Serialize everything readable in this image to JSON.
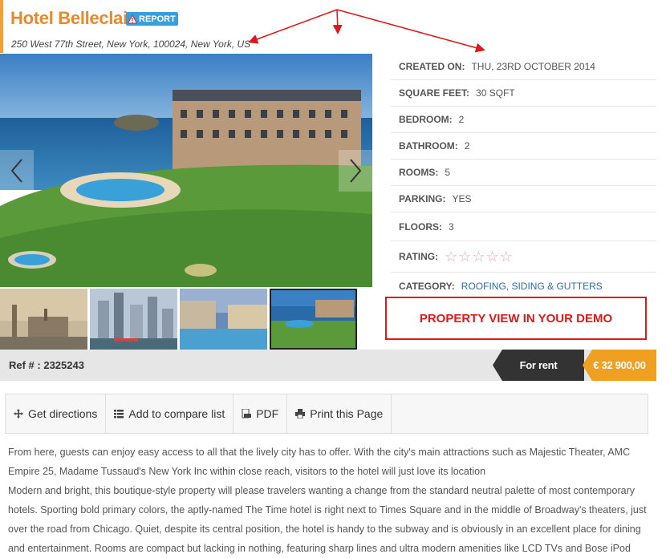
{
  "header": {
    "title": "Hotel Belleclaire",
    "report_label": "REPORT",
    "address": "250 West 77th Street, New York, 100024, New York, US",
    "accent_color": "#e8892a"
  },
  "gallery": {
    "main_image": "hotel-seaside-photo",
    "thumbnails": [
      "london-skyline-photo",
      "city-skyscrapers-photo",
      "hotel-pool-night-photo",
      "hotel-seaside-photo"
    ]
  },
  "details": {
    "created_on": {
      "label": "CREATED ON:",
      "value": "THU, 23RD OCTOBER 2014"
    },
    "square_feet": {
      "label": "SQUARE FEET:",
      "value": "30 SQFT"
    },
    "bedroom": {
      "label": "BEDROOM:",
      "value": "2"
    },
    "bathroom": {
      "label": "BATHROOM:",
      "value": "2"
    },
    "rooms": {
      "label": "ROOMS:",
      "value": "5"
    },
    "parking": {
      "label": "PARKING:",
      "value": "YES"
    },
    "floors": {
      "label": "FLOORS:",
      "value": "3"
    },
    "rating": {
      "label": "RATING:",
      "stars": 5,
      "filled": 0
    },
    "category": {
      "label": "CATEGORY:",
      "value": "ROOFING, SIDING & GUTTERS"
    }
  },
  "annotation": {
    "demo_label": "PROPERTY VIEW IN YOUR DEMO",
    "color": "#e01818"
  },
  "ref_bar": {
    "ref": "Ref # : 2325243",
    "status": "For rent",
    "price": "€ 32 900,00"
  },
  "toolbar": {
    "directions": "Get directions",
    "compare": "Add to compare list",
    "pdf": "PDF",
    "print": "Print this Page"
  },
  "description": {
    "p1": "From here, guests can enjoy easy access to all that the lively city has to offer. With the city's main attractions such as Majestic Theater, AMC Empire 25, Madame Tussaud's New York Inc within close reach, visitors to the hotel will just love its location",
    "p2": "Modern and bright, this boutique-style property will please travelers wanting a change from the standard neutral palette of most contemporary hotels. Sporting bold primary colors, the aptly-named The Time hotel is right next to Times Square and in the middle of Broadway's theaters, just over the road from Chicago. Quiet, despite its central position, the hotel is handy to the subway and is obviously in an excellent place for dining and entertainment. Rooms are compact but lacking in nothing, featuring sharp lines and ultra modern amenities like LCD TVs and Bose iPod"
  }
}
